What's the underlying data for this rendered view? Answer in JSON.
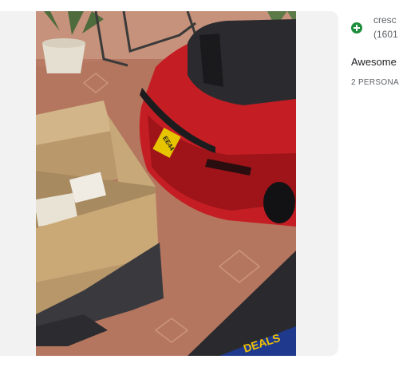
{
  "review": {
    "author": "cresc",
    "author_sub": "(1601",
    "text": "Awesome",
    "meta": "2 PERSONA"
  },
  "photo": {
    "plate_text": "EE44",
    "banner_text": "DEALS"
  },
  "icons": {
    "author_badge": "plus-circle-icon"
  },
  "colors": {
    "car_red": "#c41e24",
    "badge_green": "#1e8e3e",
    "carpet": "#b97a63",
    "box": "#c9ab7e"
  }
}
